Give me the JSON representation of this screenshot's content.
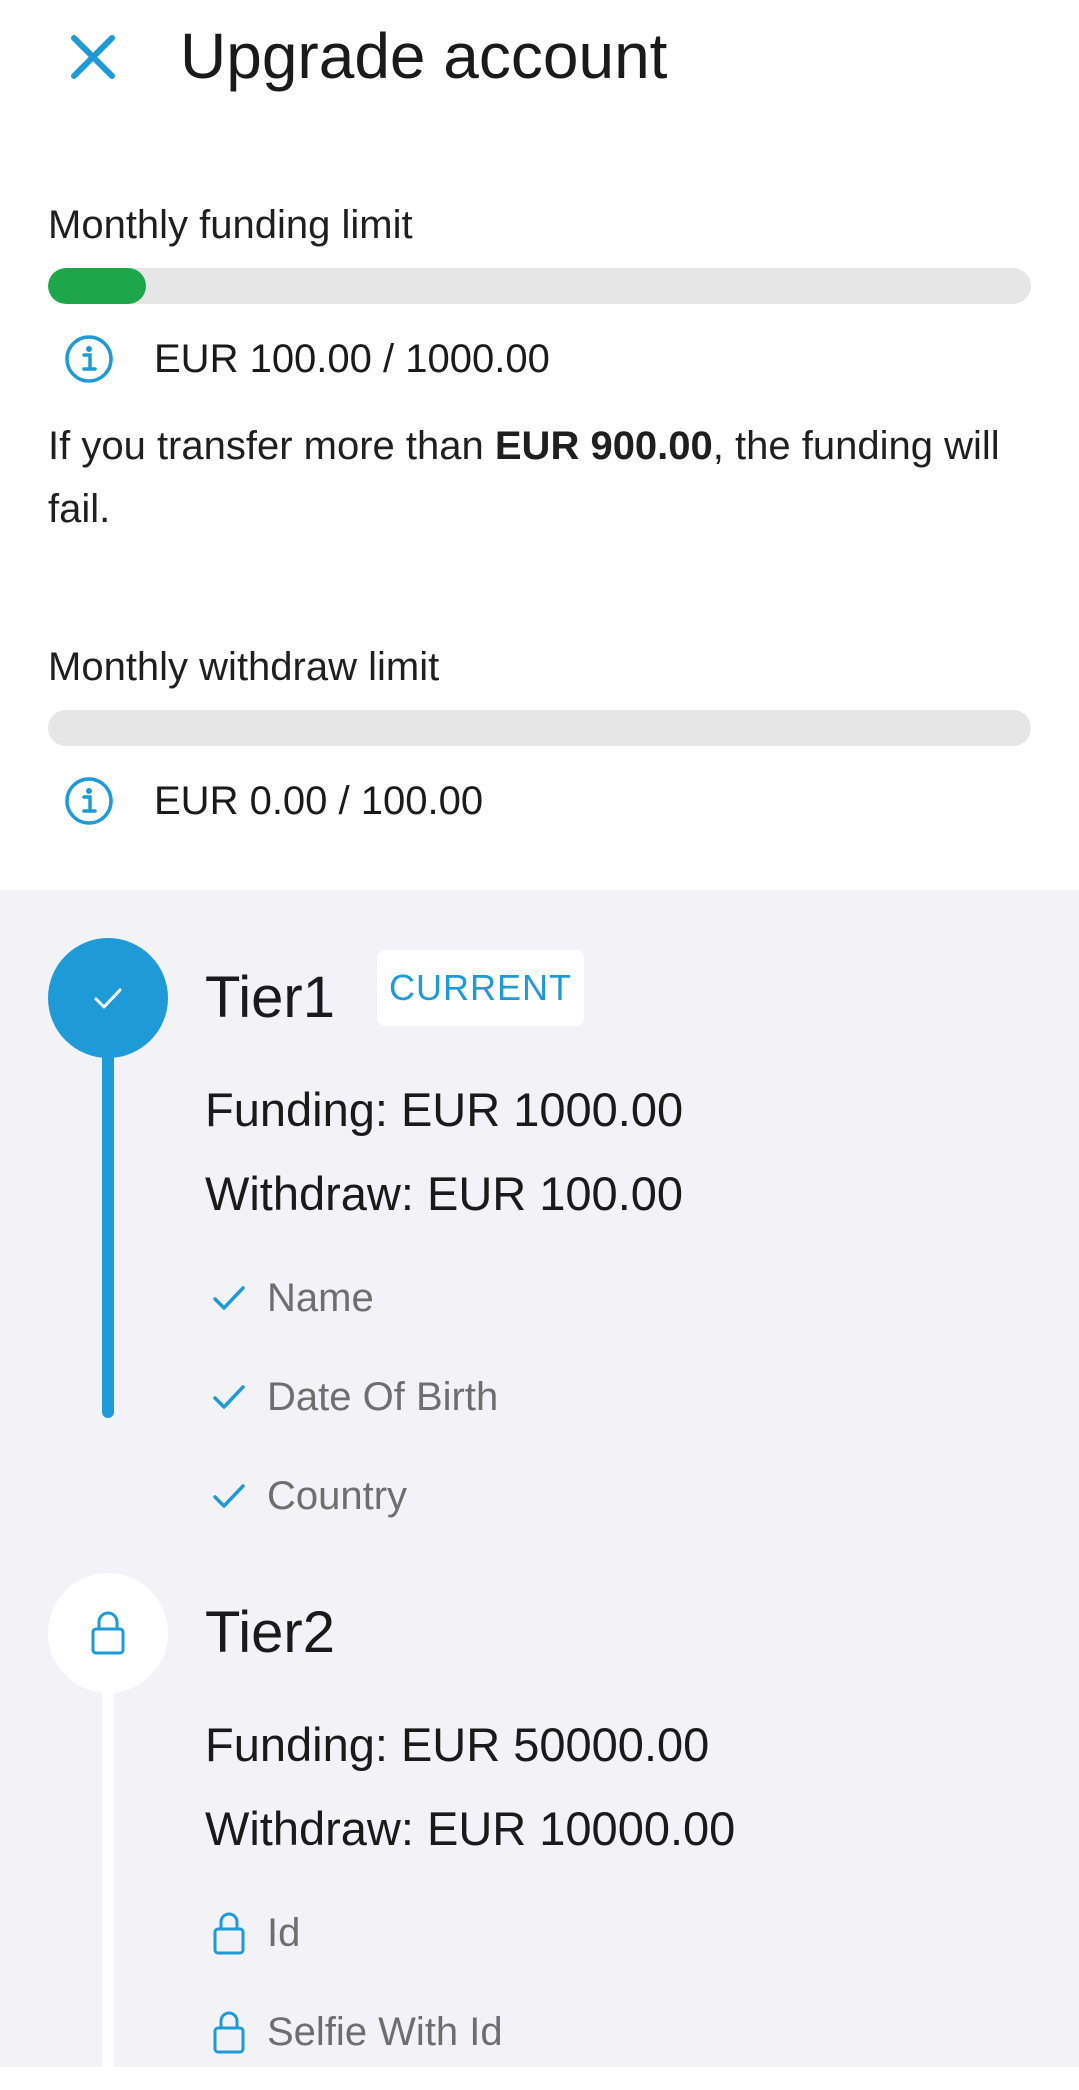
{
  "header": {
    "title": "Upgrade account",
    "close_icon": "close-icon"
  },
  "funding_limit": {
    "label": "Monthly funding limit",
    "value_text": "EUR 100.00 / 1000.00",
    "used": 100.0,
    "max": 1000.0,
    "progress_fraction": 0.1,
    "bar_color": "#1ea64a",
    "info_icon": "info-icon"
  },
  "warning": {
    "prefix": "If you transfer more than ",
    "amount": "EUR 900.00",
    "suffix": ", the funding will fail."
  },
  "withdraw_limit": {
    "label": "Monthly withdraw limit",
    "value_text": "EUR 0.00 / 100.00",
    "used": 0.0,
    "max": 100.0,
    "progress_fraction": 0,
    "info_icon": "info-icon"
  },
  "tiers": [
    {
      "title": "Tier1",
      "badge": "CURRENT",
      "status": "completed",
      "status_icon": "check-icon",
      "funding": "Funding: EUR 1000.00",
      "withdraw": "Withdraw: EUR 100.00",
      "requirements": [
        {
          "label": "Name",
          "icon": "check-icon"
        },
        {
          "label": "Date Of Birth",
          "icon": "check-icon"
        },
        {
          "label": "Country",
          "icon": "check-icon"
        }
      ]
    },
    {
      "title": "Tier2",
      "status": "locked",
      "status_icon": "lock-icon",
      "funding": "Funding: EUR 50000.00",
      "withdraw": "Withdraw: EUR 10000.00",
      "requirements": [
        {
          "label": "Id",
          "icon": "lock-icon"
        },
        {
          "label": "Selfie With Id",
          "icon": "lock-icon"
        }
      ]
    }
  ],
  "colors": {
    "accent": "#1e9ad6",
    "success": "#1ea64a",
    "track": "#e6e6e6",
    "tiers_background": "#f3f3f7"
  }
}
